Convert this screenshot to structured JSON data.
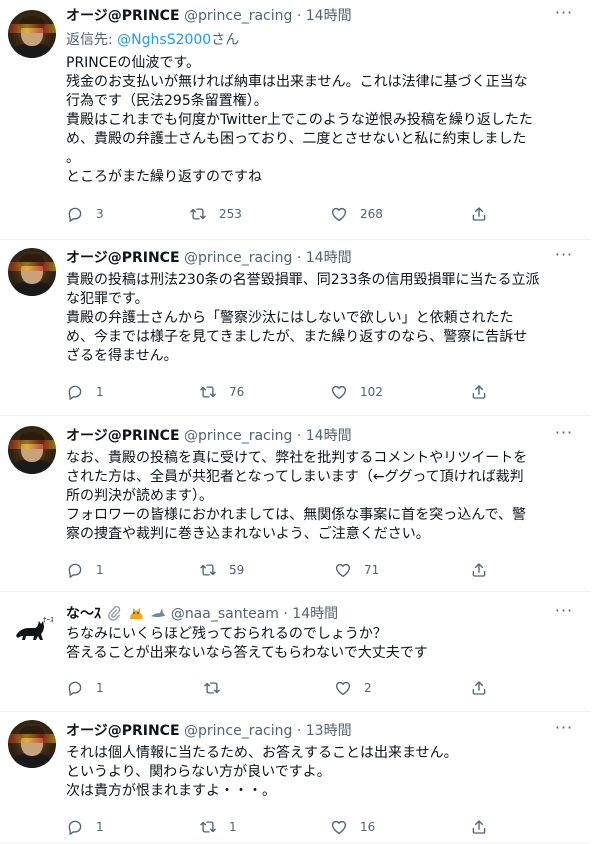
{
  "tweets": [
    {
      "name": "オージ@PRINCE",
      "handle": "@prince_racing",
      "time": "14時間",
      "reply_prefix": "返信先: ",
      "reply_mention": "@NghsS2000",
      "reply_suffix": "さん",
      "lines": [
        "PRINCEの仙波です。",
        "残金のお支払いが無ければ納車は出来ません。これは法律に基づく正当な",
        "行為です（民法295条留置権）。",
        "貴殿はこれまでも何度かTwitter上でこのような逆恨み投稿を繰り返したた",
        "め、貴殿の弁護士さんも困っており、二度とさせないと私に約束しました",
        "。",
        "ところがまた繰り返すのですね"
      ],
      "replies": "3",
      "retweets": "253",
      "likes": "268"
    },
    {
      "name": "オージ@PRINCE",
      "handle": "@prince_racing",
      "time": "14時間",
      "lines": [
        "貴殿の投稿は刑法230条の名誉毀損罪、同233条の信用毀損罪に当たる立派",
        "な犯罪です。",
        "貴殿の弁護士さんから「警察沙汰にはしないで欲しい」と依頼されたた",
        "め、今までは様子を見てきましたが、また繰り返すのなら、警察に告訴せ",
        "ざるを得ません。"
      ],
      "replies": "1",
      "retweets": "76",
      "likes": "102"
    },
    {
      "name": "オージ@PRINCE",
      "handle": "@prince_racing",
      "time": "14時間",
      "lines": [
        "なお、貴殿の投稿を真に受けて、弊社を批判するコメントやリツイートを",
        "された方は、全員が共犯者となってしまいます（←ググって頂ければ裁判",
        "所の判決が読めます）。",
        "フォロワーの皆様におかれましては、無関係な事案に首を突っ込んで、警",
        "察の捜査や裁判に巻き込まれないよう、ご注意ください。"
      ],
      "replies": "1",
      "retweets": "59",
      "likes": "71"
    },
    {
      "name": "な～ｽ",
      "handle": "@naa_santeam",
      "time": "14時間",
      "lines": [
        "ちなみにいくらほど残っておられるのでしょうか？",
        "答えることが出来ないなら答えてもらわないで大丈夫です"
      ],
      "replies": "1",
      "retweets": "",
      "likes": "2"
    },
    {
      "name": "オージ@PRINCE",
      "handle": "@prince_racing",
      "time": "13時間",
      "lines": [
        "それは個人情報に当たるため、お答えすることは出来ません。",
        "というより、関わらない方が良いですよ。",
        "次は貴方が恨まれますよ・・・。"
      ],
      "replies": "1",
      "retweets": "1",
      "likes": "16"
    }
  ],
  "separator": "·",
  "icons": {
    "more": "more-horizontal-icon",
    "reply": "reply-bubble-icon",
    "retweet": "retweet-icon",
    "like": "heart-icon",
    "share": "share-upload-icon"
  },
  "colors": {
    "text": "#0f1419",
    "secondary": "#536471",
    "link": "#1d9bf0",
    "border": "#eff3f4"
  }
}
